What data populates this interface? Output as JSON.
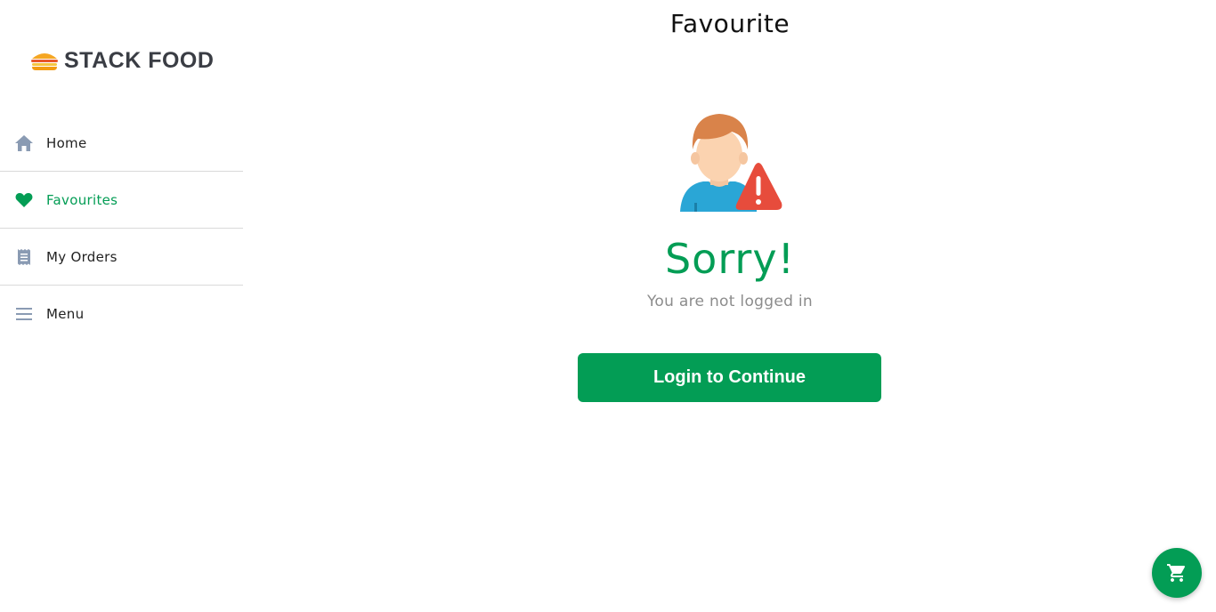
{
  "app": {
    "logo_text": "STACK FOOD",
    "accent_color": "#039d55"
  },
  "sidebar": {
    "items": [
      {
        "label": "Home",
        "icon": "home-icon",
        "active": false
      },
      {
        "label": "Favourites",
        "icon": "heart-icon",
        "active": true
      },
      {
        "label": "My Orders",
        "icon": "receipt-icon",
        "active": false
      },
      {
        "label": "Menu",
        "icon": "menu-icon",
        "active": false
      }
    ]
  },
  "main": {
    "title": "Favourite",
    "illustration": "user-warning-icon",
    "heading": "Sorry!",
    "message": "You are not logged in",
    "login_button": "Login to Continue"
  },
  "fab": {
    "icon": "cart-icon"
  }
}
